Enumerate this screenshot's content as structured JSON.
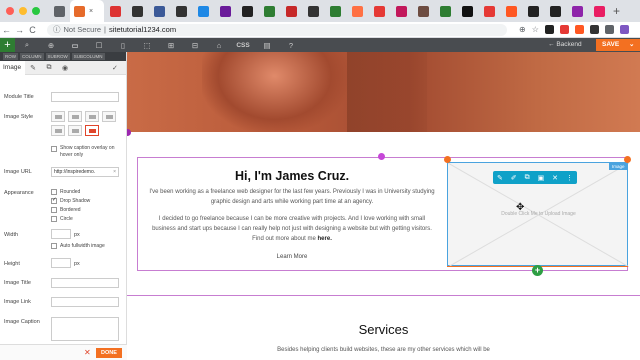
{
  "browser": {
    "active_tab_close": "×",
    "tab_favicons": [
      "#5f6368",
      "#e66b2b",
      "#d33",
      "#333",
      "#3b5998",
      "#333",
      "#1e88e5",
      "#6a1b9a",
      "#222",
      "#2e7d32",
      "#c62828",
      "#333",
      "#2e7d32",
      "#ff7043",
      "#e53935",
      "#c2185b",
      "#6d4c41",
      "#2e7d32",
      "#111",
      "#e53935",
      "#ff5722",
      "#222",
      "#222",
      "#8e24aa",
      "#e91e63"
    ],
    "new_tab": "+",
    "back": "←",
    "forward": "→",
    "reload": "C",
    "security": "Not Secure",
    "url": "sitetutorial1234.com",
    "right_icons": [
      "⊕",
      "☆"
    ],
    "extension_colors": [
      "#222",
      "#e53935",
      "#ff5722",
      "#333",
      "#5f6368",
      "#7e57c2"
    ]
  },
  "builder_bar": {
    "add": "+",
    "icons": [
      "⌕",
      "⊕",
      "▭",
      "☐",
      "▯",
      "⬚",
      "⊞",
      "⊟",
      "⌂"
    ],
    "css_label": "CSS",
    "help": "?",
    "backend_label": "Backend",
    "save_label": "SAVE"
  },
  "sidebar": {
    "crumbs": [
      "ROW",
      "COLUMN",
      "SUBROW",
      "SUBCOLUMN"
    ],
    "module_title": "Image",
    "fields": {
      "module_title": "Module Title",
      "image_style": "Image Style",
      "show_caption": "Show caption overlay on hover only",
      "image_url": "Image URL",
      "image_url_value": "http://inspiredemo.",
      "appearance": "Appearance",
      "rounded": "Rounded",
      "drop_shadow": "Drop Shadow",
      "bordered": "Bordered",
      "circle": "Circle",
      "width": "Width",
      "px": "px",
      "auto_fullwidth": "Auto fullwidth image",
      "height": "Height",
      "image_title": "Image Title",
      "image_link": "Image Link",
      "image_caption": "Image Caption"
    },
    "done_label": "DONE",
    "close": "✕"
  },
  "page": {
    "heading": "Hi, I'm James Cruz.",
    "para1": "I've been working as a freelance web designer for the last few years. Previously I was in University studying graphic design and arts while working part time at an agency.",
    "para2_prefix": "I decided to go freelance because I can be more creative with projects. And I love working with small business and start ups because I can really help not just with designing a website but with getting visitors. Find out more about me ",
    "para2_link": "here.",
    "learn_more": "Learn More",
    "image_placeholder": "Double Click Me to Upload Image",
    "image_tag": "Image",
    "services_title": "Services",
    "services_text": "Besides helping clients build websites, these are my other services which will be"
  }
}
